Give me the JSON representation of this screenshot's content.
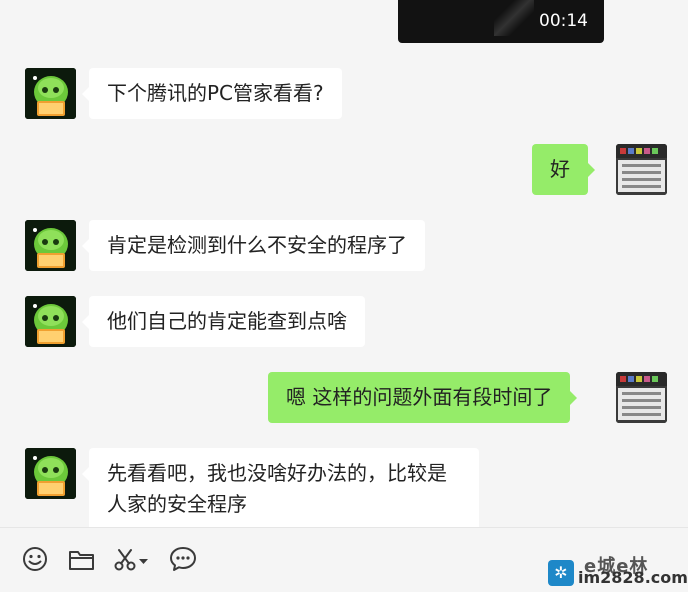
{
  "chat": {
    "video": {
      "duration": "00:14"
    },
    "messages": [
      {
        "side": "left",
        "text": "下个腾讯的PC管家看看?"
      },
      {
        "side": "right",
        "text": "好"
      },
      {
        "side": "left",
        "text": "肯定是检测到什么不安全的程序了"
      },
      {
        "side": "left",
        "text": "他们自己的肯定能查到点啥"
      },
      {
        "side": "right",
        "text": "嗯   这样的问题外面有段时间了"
      },
      {
        "side": "left",
        "line1": "先看看吧，我也没啥好办法的，比较是",
        "line2": "人家的安全程序"
      }
    ]
  },
  "toolbar": {
    "icons": [
      "emoji-icon",
      "folder-icon",
      "scissors-icon",
      "chevron-down-icon",
      "chat-history-icon"
    ]
  },
  "watermark": {
    "brand": "e城e林",
    "site": "im2828.com",
    "logo_glyph": "✲"
  },
  "colors": {
    "background": "#f5f5f5",
    "bubble_received": "#ffffff",
    "bubble_sent": "#95ec69",
    "video_bg": "#121212"
  }
}
